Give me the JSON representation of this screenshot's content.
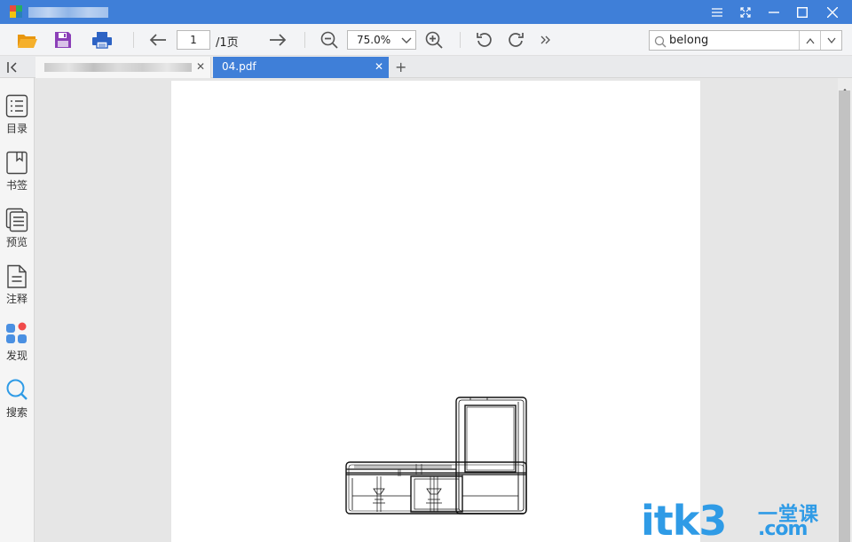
{
  "window": {
    "title_blurred": true,
    "controls": [
      "menu-icon",
      "fullscreen-icon",
      "minimize-icon",
      "maximize-icon",
      "close-icon"
    ]
  },
  "toolbar": {
    "icons": [
      "open-folder-icon",
      "save-icon",
      "print-icon",
      "arrow-left-icon",
      "arrow-right-icon",
      "zoom-out-icon",
      "zoom-in-icon",
      "rotate-left-icon",
      "rotate-right-icon",
      "more-icon"
    ],
    "page_number": "1",
    "page_total": "/1页",
    "zoom": "75.0%",
    "search_value": "belong"
  },
  "tabs": [
    {
      "label_blurred": true,
      "active": false
    },
    {
      "label": "04.pdf",
      "active": true
    }
  ],
  "sidebar": {
    "items": [
      {
        "label": "目录",
        "icon": "toc-icon"
      },
      {
        "label": "书签",
        "icon": "bookmark-icon"
      },
      {
        "label": "预览",
        "icon": "thumbnails-icon"
      },
      {
        "label": "注释",
        "icon": "annotation-icon"
      },
      {
        "label": "发现",
        "icon": "discover-icon"
      },
      {
        "label": "搜索",
        "icon": "search-icon"
      }
    ]
  },
  "watermark": {
    "brand": "itk3",
    "cn": "一堂课",
    "domain": ".com"
  },
  "colors": {
    "titlebar": "#3f7fd8",
    "active_tab": "#3f7fd8",
    "open_icon": "#f0a820",
    "save_icon": "#8b3fb8",
    "print_icon": "#2d63c4",
    "watermark": "#2f9be6"
  }
}
